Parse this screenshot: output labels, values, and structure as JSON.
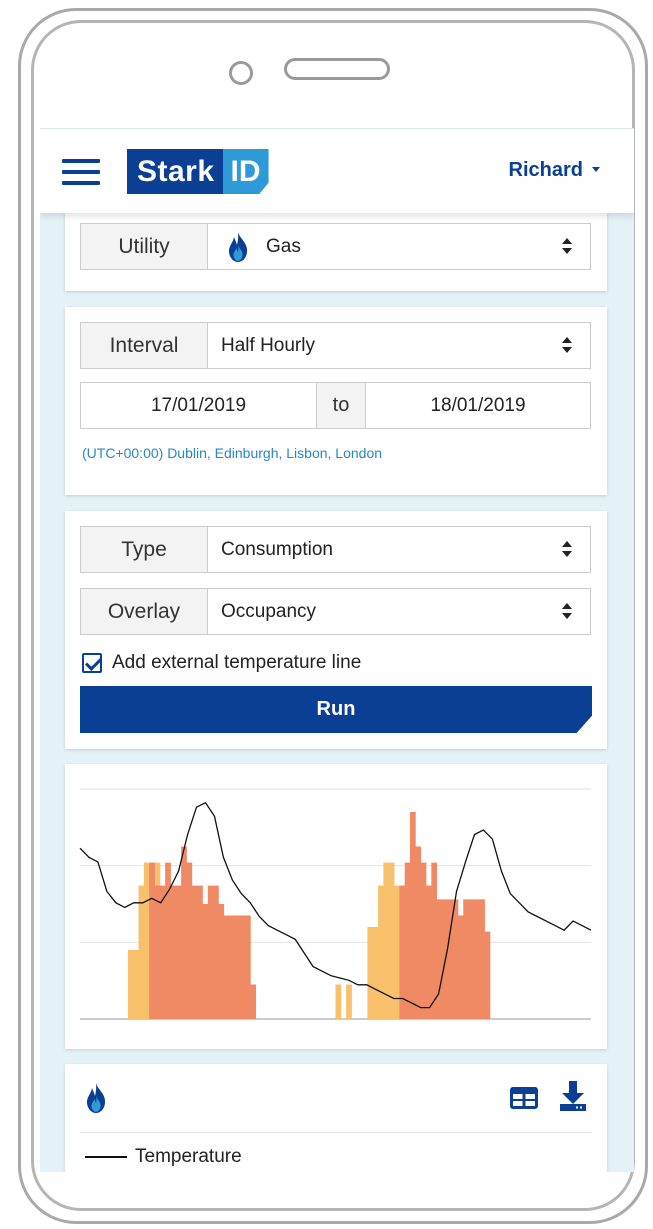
{
  "header": {
    "logo_left": "Stark",
    "logo_right": "ID",
    "user_name": "Richard"
  },
  "utility": {
    "label": "Utility",
    "value": "Gas",
    "icon": "gas-flame-icon"
  },
  "interval": {
    "label": "Interval",
    "value": "Half Hourly",
    "date_from": "17/01/2019",
    "date_separator": "to",
    "date_to": "18/01/2019",
    "timezone": "(UTC+00:00) Dublin, Edinburgh, Lisbon, London"
  },
  "type_filter": {
    "type_label": "Type",
    "type_value": "Consumption",
    "overlay_label": "Overlay",
    "overlay_value": "Occupancy",
    "temperature_checkbox_label": "Add external temperature line",
    "temperature_checked": true,
    "run_label": "Run"
  },
  "colors": {
    "brand_dark": "#0b3f93",
    "brand_light": "#2f9ad8",
    "consumption_bar": "#f08a64",
    "occupancy_bar": "#f8c06a",
    "temperature_line": "#111111"
  },
  "chart_data": {
    "type": "bar",
    "series": [
      {
        "values": [
          0,
          0,
          0,
          0,
          0,
          0,
          0,
          0,
          0,
          0,
          0,
          0,
          0,
          0,
          4,
          4,
          5,
          5,
          3,
          3,
          3,
          3,
          3,
          3,
          0,
          0,
          0,
          0,
          0,
          0,
          0,
          0,
          0,
          0,
          0,
          0,
          0,
          0,
          0,
          0,
          0,
          0,
          0,
          0,
          0,
          0,
          0,
          0,
          0,
          0,
          0,
          0,
          1,
          1,
          4,
          4,
          5,
          5,
          3,
          3,
          3,
          3,
          3,
          3,
          0,
          0,
          0,
          0,
          0,
          0,
          0,
          0,
          0,
          0,
          0,
          0,
          0,
          0,
          0,
          0,
          0,
          0,
          0,
          0,
          0,
          0,
          0,
          0,
          0,
          0,
          0,
          0,
          0,
          0,
          0,
          0
        ]
      },
      {
        "values": [
          0,
          0,
          0,
          0,
          0,
          0,
          0,
          0,
          0,
          0,
          0,
          0,
          0,
          0,
          0,
          0,
          0,
          0,
          0,
          0,
          0,
          0,
          0,
          0,
          0,
          0,
          0,
          0,
          0,
          0,
          0,
          0,
          0,
          0,
          0,
          0,
          0,
          0,
          0,
          0,
          0,
          0,
          0,
          0,
          0,
          0,
          0,
          0,
          0,
          0,
          0,
          0,
          0,
          0,
          0,
          0,
          0,
          0,
          0,
          0,
          0,
          0,
          0,
          0,
          0,
          0,
          0,
          0,
          0,
          0,
          0,
          0,
          0,
          0,
          0,
          0,
          0,
          0,
          0,
          0,
          0,
          0,
          0,
          0,
          0,
          0,
          0,
          0,
          0,
          0,
          0,
          0,
          0,
          0,
          0,
          0
        ]
      }
    ],
    "consumption": [
      0,
      0,
      0,
      0,
      0,
      0,
      0,
      0,
      0,
      0,
      0,
      0,
      0,
      0,
      0,
      0,
      0,
      0,
      0,
      0,
      0,
      0,
      68,
      68,
      82,
      92,
      82,
      90,
      95,
      85,
      78,
      78,
      70,
      70,
      55,
      55,
      0,
      0,
      0,
      0,
      0,
      0,
      0,
      0,
      0,
      0,
      0,
      0,
      0,
      0,
      0,
      0,
      0,
      0,
      0,
      0,
      0,
      0,
      0,
      0,
      0,
      0,
      0,
      0,
      0,
      0,
      0,
      0,
      0,
      0,
      0,
      0,
      0,
      0,
      0,
      0,
      0,
      0,
      0,
      0,
      0,
      0,
      0,
      0,
      0,
      0,
      0,
      0,
      0,
      0,
      0,
      0,
      0,
      0,
      0,
      0
    ],
    "occupancy": [
      0,
      0,
      0,
      0,
      0,
      0,
      0,
      0,
      0,
      0,
      0,
      0,
      0,
      0,
      0,
      0,
      0,
      0,
      0,
      0,
      0,
      0,
      0,
      0,
      0,
      0,
      0,
      0,
      0,
      0,
      0,
      0,
      0,
      0,
      0,
      0,
      0,
      0,
      0,
      0,
      0,
      0,
      0,
      0,
      0,
      0,
      0,
      0,
      0,
      0,
      0,
      0,
      0,
      0,
      0,
      0,
      0,
      0,
      0,
      0,
      0,
      0,
      0,
      0,
      0,
      0,
      0,
      0,
      0,
      0,
      0,
      0,
      0,
      0,
      0,
      0,
      0,
      0,
      0,
      0,
      0,
      0,
      0,
      0,
      0,
      0,
      0,
      0,
      0,
      0,
      0,
      0,
      0,
      0,
      0,
      0
    ],
    "temperature": [],
    "grid": true
  },
  "legend": {
    "utility_icon": "gas-flame-icon",
    "table_icon": "table-icon",
    "download_icon": "download-icon",
    "temperature_label": "Temperature"
  }
}
